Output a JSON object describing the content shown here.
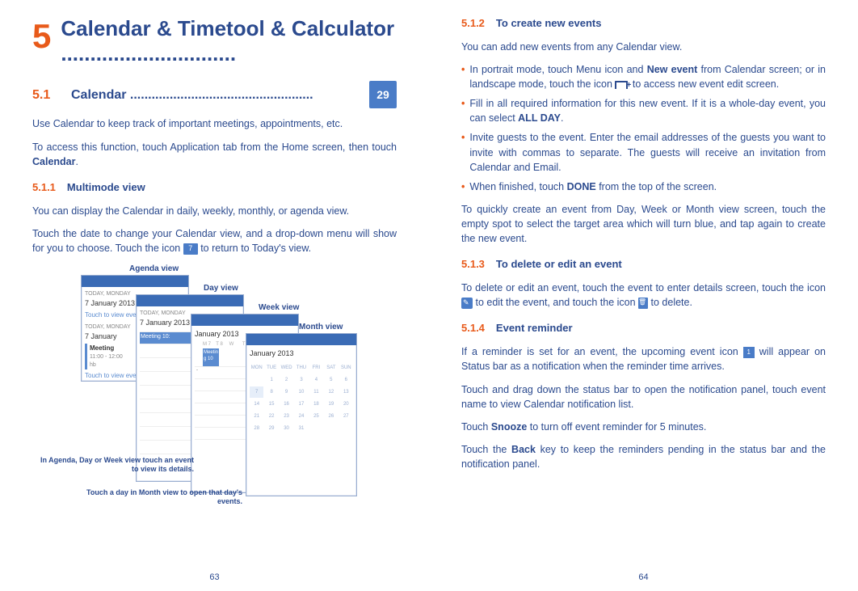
{
  "left": {
    "chapter_num": "5",
    "chapter_title": "Calendar & Timetool & Calculator ..............................",
    "sec1_num": "5.1",
    "sec1_title": "Calendar ...................................................",
    "cal_icon_num": "29",
    "p1": "Use Calendar to keep track of important meetings, appointments, etc.",
    "p2a": "To access this function, touch Application tab from the Home screen, then touch ",
    "p2b": "Calendar",
    "p2c": ".",
    "sub1_num": "5.1.1",
    "sub1_title": "Multimode view",
    "p3": "You can display the Calendar in daily, weekly, monthly, or agenda view.",
    "p4a": "Touch the date to change your Calendar view, and a drop-down menu will show for you to choose. Touch the icon ",
    "p4_iconnum": "7",
    "p4b": " to return to Today's view.",
    "fig": {
      "agenda": "Agenda view",
      "day": "Day view",
      "week": "Week view",
      "month": "Month view",
      "note1": "In Agenda, Day or Week view touch an event to view its details.",
      "note2": "Touch a day in Month view to open that day's events.",
      "date_header": "7 January 2013",
      "month_header": "January 2013",
      "touch_txt": "Touch to view events",
      "meeting_title": "Meeting",
      "meeting_time": "11:00 - 12:00",
      "meeting_sub": "hb"
    },
    "page_num": "63"
  },
  "right": {
    "sub2_num": "5.1.2",
    "sub2_title": "To create new events",
    "r_p1": "You can add new events from any Calendar view.",
    "b1a": "In portrait mode, touch Menu icon and ",
    "b1b": "New event",
    "b1c": " from Calendar screen; or in landscape mode, touch the icon ",
    "b1d": " to access new event edit screen.",
    "b2a": "Fill in all required information for this new event. If it is a whole-day event, you can select ",
    "b2b": "ALL DAY",
    "b2c": ".",
    "b3": "Invite guests to the event. Enter the email addresses of the guests you want to invite with commas to separate. The guests will receive an invitation from Calendar and Email.",
    "b4a": "When finished, touch ",
    "b4b": "DONE",
    "b4c": " from the top of the screen.",
    "r_p2": "To quickly create an event from Day, Week or Month view screen, touch the empty spot to select the target area which will turn blue, and tap again to create the new event.",
    "sub3_num": "5.1.3",
    "sub3_title": "To delete or edit an event",
    "r_p3a": "To delete or edit an event, touch the event to enter details screen, touch the icon ",
    "r_p3b": " to edit the event, and touch the icon ",
    "r_p3c": " to delete.",
    "sub4_num": "5.1.4",
    "sub4_title": "Event reminder",
    "r_p4a": "If a reminder is set for an event, the upcoming event icon ",
    "r_p4_iconnum": "1",
    "r_p4b": " will appear on Status bar as a notification when the reminder time arrives.",
    "r_p5": "Touch and drag down the status bar to open the notification panel, touch event name to view Calendar notification list.",
    "r_p6a": "Touch ",
    "r_p6b": "Snooze",
    "r_p6c": " to turn off event reminder for 5 minutes.",
    "r_p7a": "Touch the ",
    "r_p7b": "Back",
    "r_p7c": " key to keep the reminders pending in the status bar and the notification panel.",
    "page_num": "64"
  }
}
